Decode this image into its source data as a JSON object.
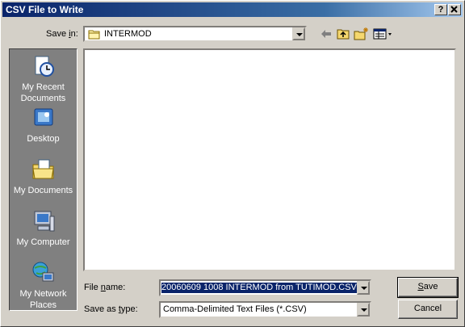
{
  "window": {
    "title": "CSV File to Write",
    "help_label": "?",
    "close_label": "X"
  },
  "save_in": {
    "label_pre": "Save ",
    "label_ul": "i",
    "label_post": "n:",
    "value": "INTERMOD"
  },
  "places": [
    {
      "name": "my-recent-documents",
      "label_line1": "My Recent",
      "label_line2": "Documents"
    },
    {
      "name": "desktop",
      "label_line1": "Desktop",
      "label_line2": ""
    },
    {
      "name": "my-documents",
      "label_line1": "My Documents",
      "label_line2": ""
    },
    {
      "name": "my-computer",
      "label_line1": "My Computer",
      "label_line2": ""
    },
    {
      "name": "my-network-places",
      "label_line1": "My Network",
      "label_line2": "Places"
    }
  ],
  "file_name": {
    "label_pre": "File ",
    "label_ul": "n",
    "label_post": "ame:",
    "value": "20060609 1008 INTERMOD from TUTIMOD.CSV"
  },
  "save_type": {
    "label_pre": "Save as ",
    "label_ul": "t",
    "label_post": "ype:",
    "value": "Comma-Delimited Text Files (*.CSV)"
  },
  "buttons": {
    "save_ul": "S",
    "save_rest": "ave",
    "cancel": "Cancel"
  },
  "colors": {
    "title_start": "#0a246a",
    "title_end": "#a6caf0",
    "face": "#d4d0c8",
    "places_bg": "#808080",
    "selection": "#0a246a"
  }
}
